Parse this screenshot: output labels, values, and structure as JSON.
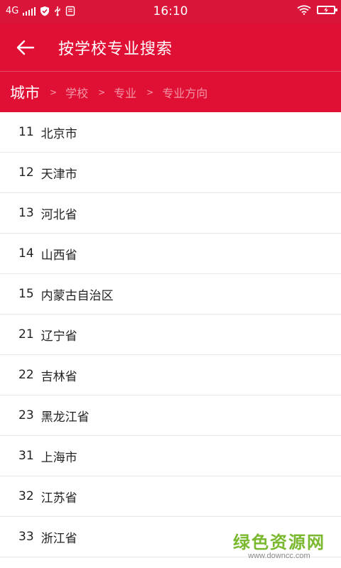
{
  "status_bar": {
    "network": "4G",
    "time": "16:10"
  },
  "header": {
    "title": "按学校专业搜索"
  },
  "breadcrumb": {
    "active": "城市",
    "separator": ">",
    "steps": [
      "学校",
      "专业",
      "专业方向"
    ]
  },
  "list": [
    {
      "code": "11",
      "name": "北京市"
    },
    {
      "code": "12",
      "name": "天津市"
    },
    {
      "code": "13",
      "name": "河北省"
    },
    {
      "code": "14",
      "name": "山西省"
    },
    {
      "code": "15",
      "name": "内蒙古自治区"
    },
    {
      "code": "21",
      "name": "辽宁省"
    },
    {
      "code": "22",
      "name": "吉林省"
    },
    {
      "code": "23",
      "name": "黑龙江省"
    },
    {
      "code": "31",
      "name": "上海市"
    },
    {
      "code": "32",
      "name": "江苏省"
    },
    {
      "code": "33",
      "name": "浙江省"
    }
  ],
  "watermark": {
    "main": "绿色资源网",
    "sub": "www.downcc.com"
  },
  "colors": {
    "status_bar": "#d9163a",
    "primary": "#e01035",
    "watermark_green": "#7ab92f"
  }
}
